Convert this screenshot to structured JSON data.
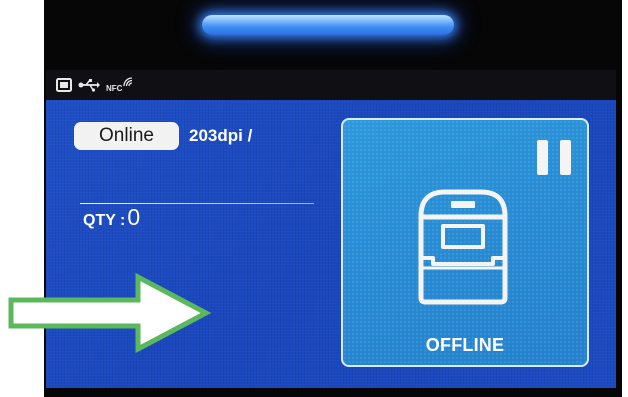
{
  "header": {
    "status_icons": [
      "storage-icon",
      "usb-icon",
      "nfc-icon"
    ],
    "nfc_label": "NFC"
  },
  "main": {
    "connection_status": "Online",
    "resolution": "203dpi /",
    "qty_label": "QTY :",
    "qty_value": "0"
  },
  "status_panel": {
    "icon": "printer-icon",
    "state_label": "OFFLINE",
    "pause_icon": "pause-icon"
  },
  "annotation": {
    "icon": "right-arrow-icon",
    "color": "#5cb85c"
  },
  "colors": {
    "screen_background": "#1c4ac2",
    "panel_background": "#2689d2",
    "light_bar": "#3f8ef7"
  }
}
